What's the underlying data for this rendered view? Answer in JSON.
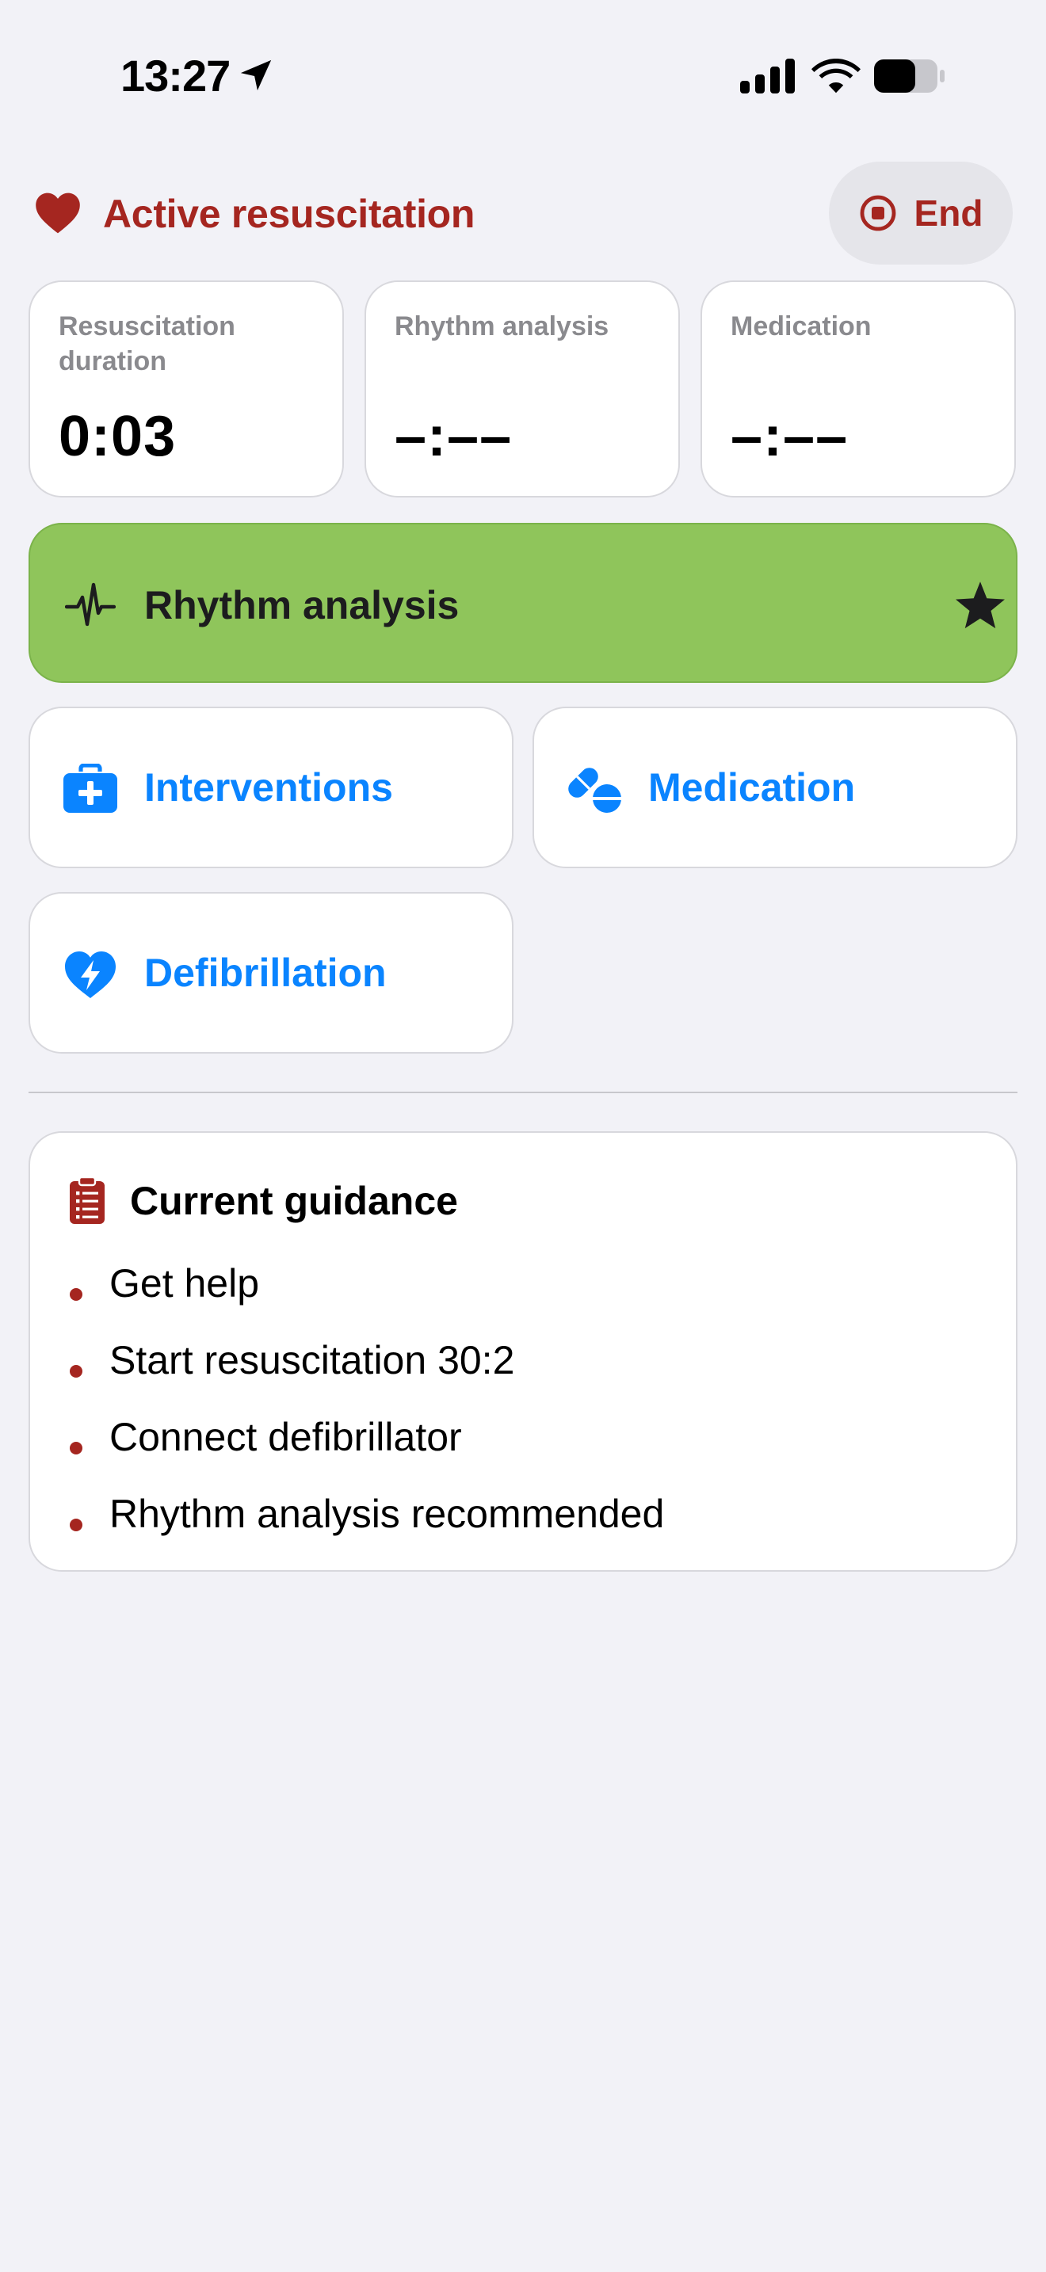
{
  "status_bar": {
    "time": "13:27",
    "location_icon": "location-arrow-icon",
    "signal_icon": "cellular-signal-icon",
    "wifi_icon": "wifi-icon",
    "battery_icon": "battery-icon",
    "battery_level": 0.6
  },
  "header": {
    "icon": "heart-icon",
    "title": "Active resuscitation",
    "end_button": {
      "icon": "stop-circle-icon",
      "label": "End"
    }
  },
  "timers": [
    {
      "label": "Resuscitation duration",
      "value": "0:03"
    },
    {
      "label": "Rhythm analysis",
      "value": "–:––"
    },
    {
      "label": "Medication",
      "value": "–:––"
    }
  ],
  "rhythm_button": {
    "icon": "waveform-icon",
    "label": "Rhythm analysis",
    "badge_icon": "star-icon",
    "color": "#8fc55b"
  },
  "actions": [
    {
      "icon": "medical-kit-icon",
      "label": "Interventions"
    },
    {
      "icon": "pills-icon",
      "label": "Medication"
    },
    {
      "icon": "heart-bolt-icon",
      "label": "Defibrillation"
    }
  ],
  "guidance": {
    "icon": "clipboard-icon",
    "title": "Current guidance",
    "items": [
      "Get help",
      "Start resuscitation 30:2",
      "Connect defibrillator",
      "Rhythm analysis recommended"
    ]
  },
  "colors": {
    "accent_red": "#a52620",
    "action_blue": "#0a84ff",
    "rhythm_green": "#8fc55b",
    "background": "#f2f2f7"
  }
}
